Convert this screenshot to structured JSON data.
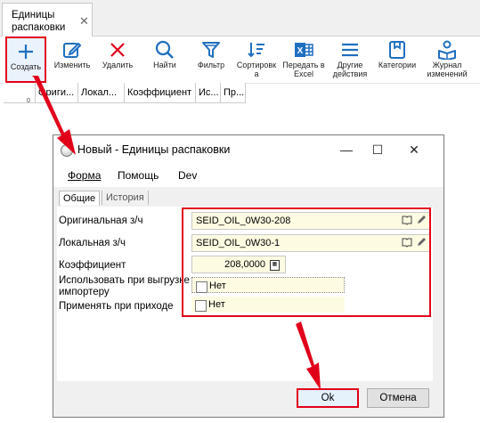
{
  "tab": {
    "title": "Единицы распаковки",
    "close": "✕"
  },
  "toolbar": {
    "items": [
      {
        "label": "Создать",
        "icon": "plus-icon"
      },
      {
        "label": "Изменить",
        "icon": "edit-icon"
      },
      {
        "label": "Удалить",
        "icon": "delete-icon"
      },
      {
        "label": "Найти",
        "icon": "search-icon"
      },
      {
        "label": "Фильтр",
        "icon": "filter-icon"
      },
      {
        "label": "Сортировка",
        "icon": "sort-icon"
      },
      {
        "label": "Передать в Excel",
        "icon": "excel-icon"
      },
      {
        "label": "Другие действия",
        "icon": "menu-icon"
      },
      {
        "label": "Категории",
        "icon": "categories-icon"
      },
      {
        "label": "Журнал изменений",
        "icon": "changelog-icon"
      }
    ]
  },
  "grid": {
    "columns": [
      "Ориги...",
      "Локал...",
      "Коэффициент",
      "Ис...",
      "Пр..."
    ],
    "row_count": "0"
  },
  "dialog": {
    "title": "Новый - Единицы распаковки",
    "controls": {
      "minimize": "—",
      "maximize": "☐",
      "close": "✕"
    },
    "menu": [
      "Форма",
      "Помощь",
      "Dev"
    ],
    "tabs": [
      "Общие",
      "История"
    ],
    "fields": {
      "original_label": "Оригинальная з/ч",
      "original_value": "SEID_OIL_0W30-208",
      "local_label": "Локальная з/ч",
      "local_value": "SEID_OIL_0W30-1",
      "coef_label": "Коэффициент",
      "coef_value": "208,0000",
      "use_export_label": "Использовать при выгрузке импортеру",
      "use_export_value": "Нет",
      "apply_receipt_label": "Применять при приходе",
      "apply_receipt_value": "Нет"
    },
    "buttons": {
      "ok": "Ok",
      "cancel": "Отмена"
    }
  },
  "colors": {
    "accent": "#1f6fbf",
    "highlight": "#e1001a",
    "field_bg": "#fdfbe2"
  }
}
